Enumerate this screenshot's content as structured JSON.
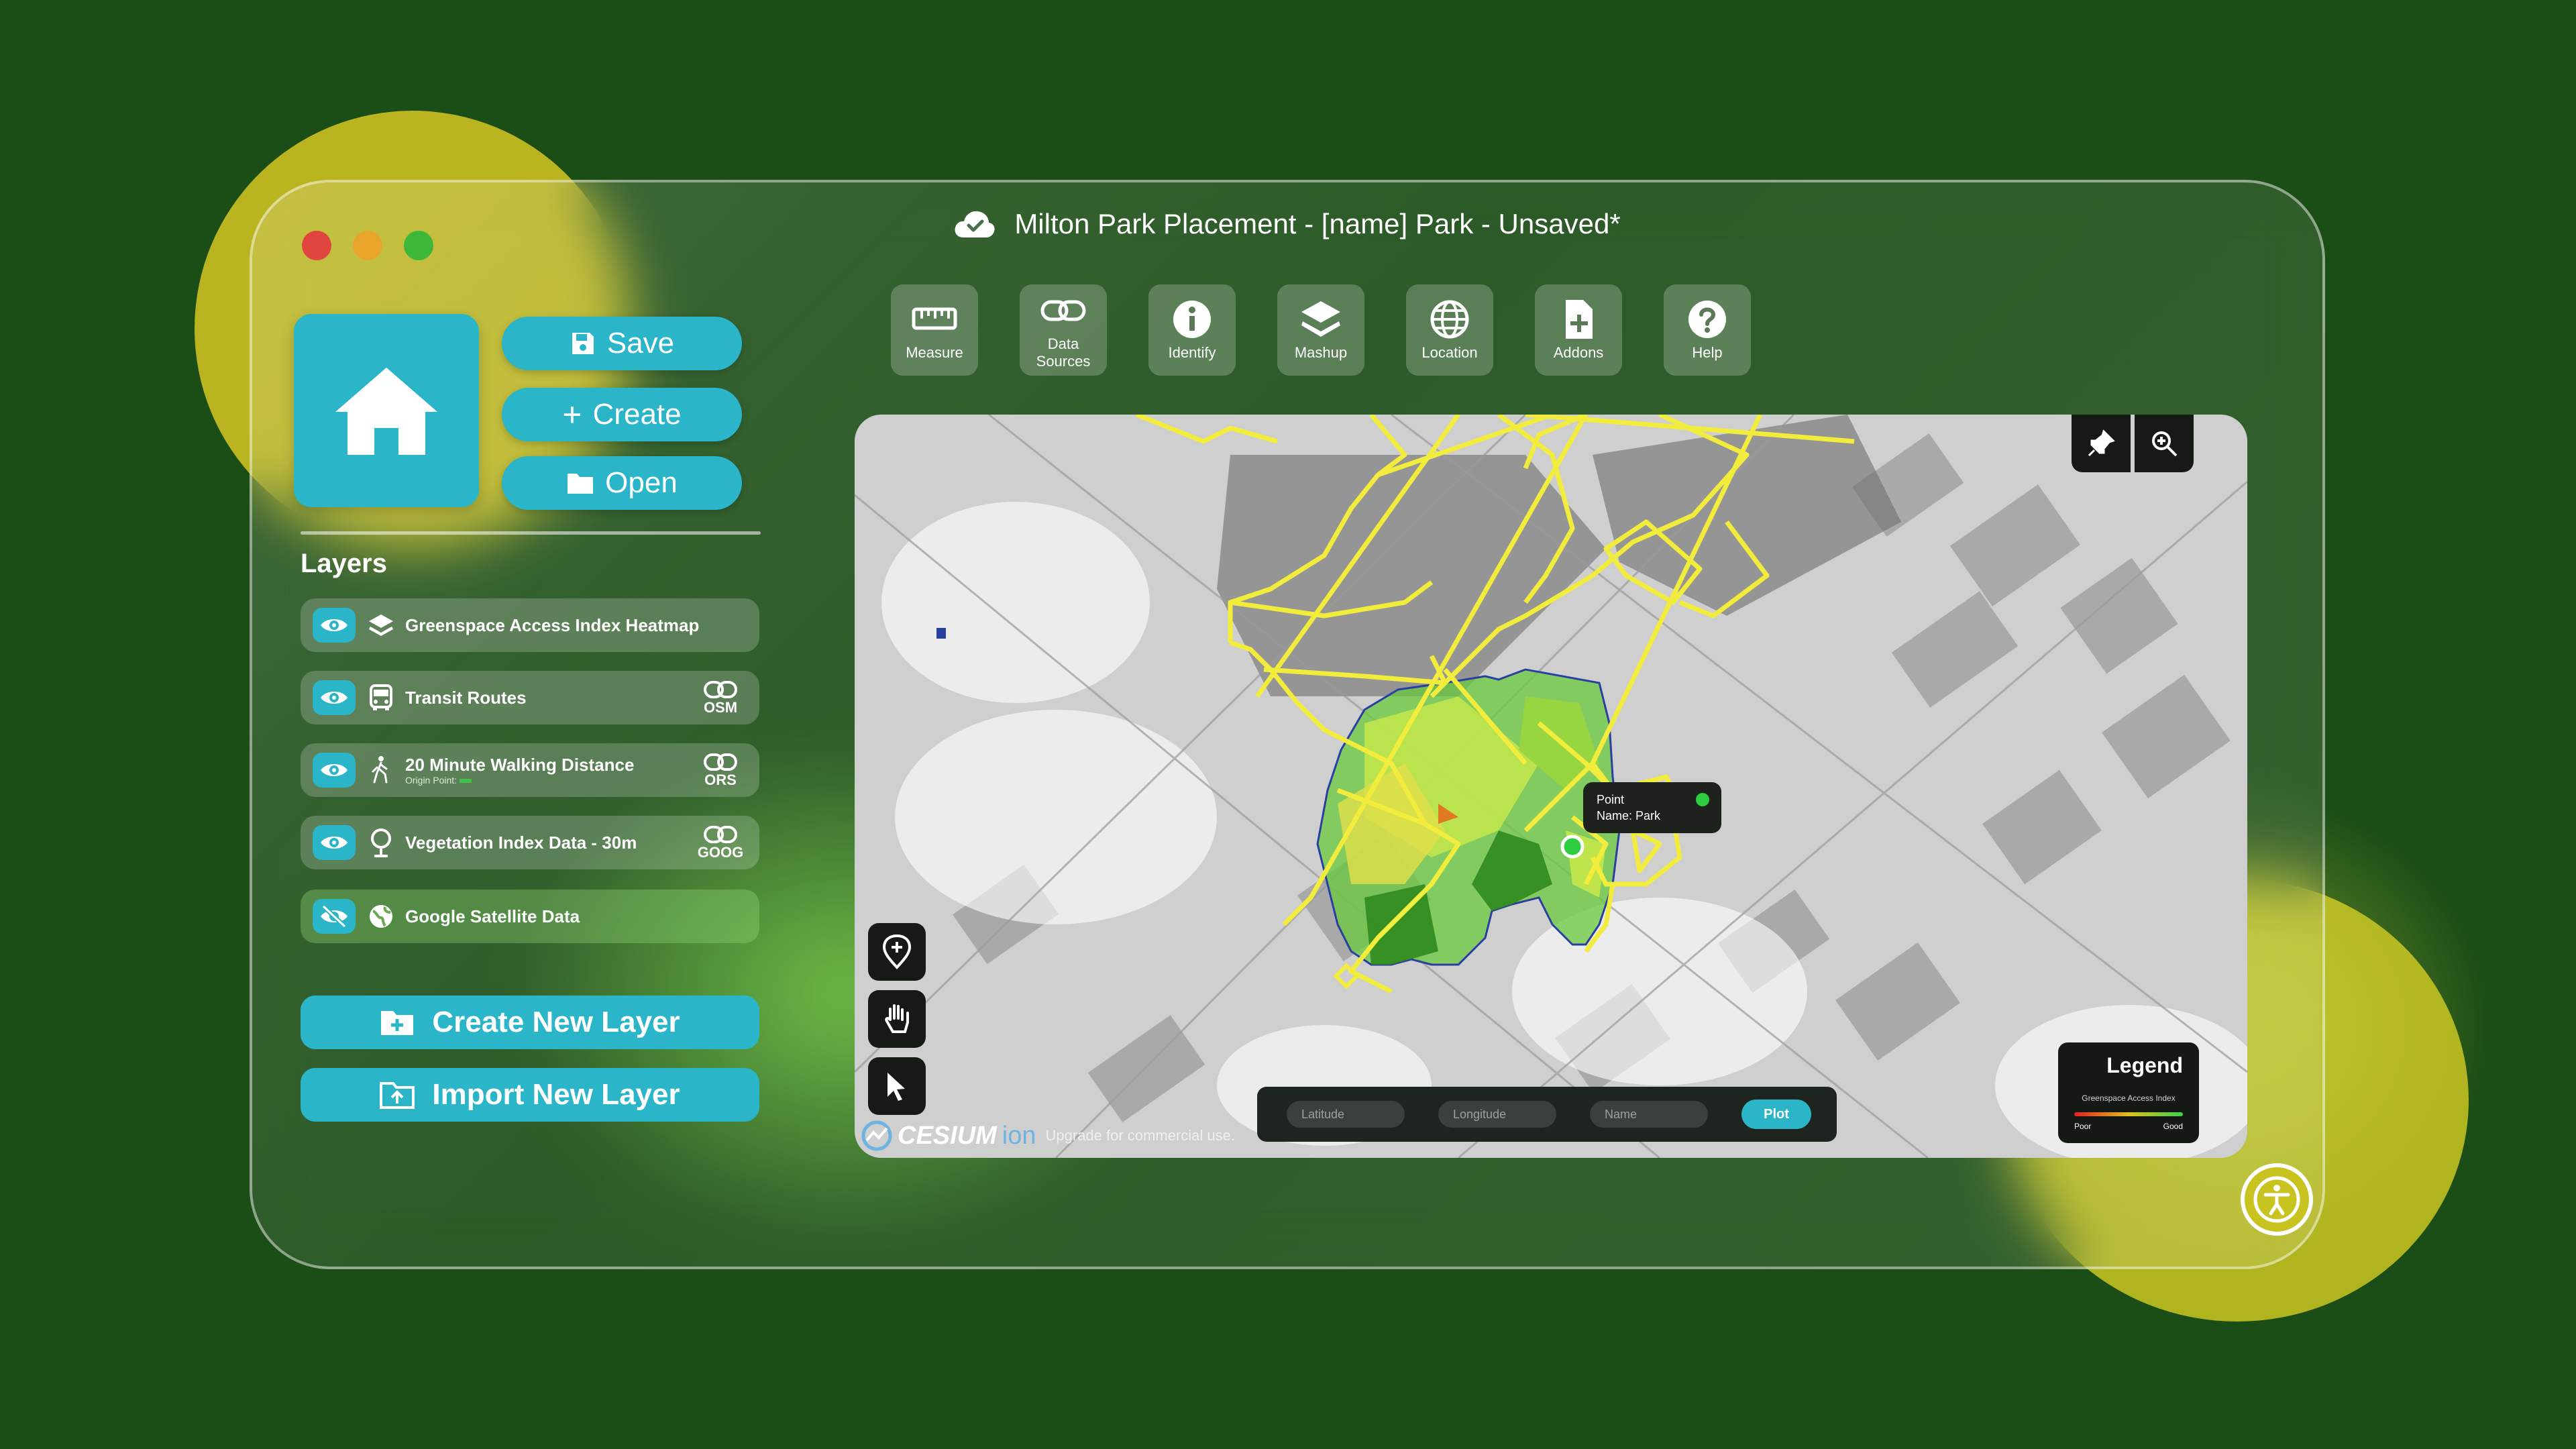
{
  "window": {
    "title": "Milton Park Placement - [name] Park - Unsaved*"
  },
  "actions": {
    "save": "Save",
    "create": "Create",
    "open": "Open"
  },
  "toolbar": {
    "measure": "Measure",
    "data_sources_1": "Data",
    "data_sources_2": "Sources",
    "identify": "Identify",
    "mashup": "Mashup",
    "location": "Location",
    "addons": "Addons",
    "help": "Help"
  },
  "layers": {
    "title": "Layers",
    "items": [
      {
        "label": "Greenspace Access Index Heatmap",
        "visible": true,
        "icon": "stack-icon"
      },
      {
        "label": "Transit Routes",
        "visible": true,
        "icon": "bus-icon",
        "source": "OSM"
      },
      {
        "label": "20 Minute Walking Distance",
        "sub": "Origin Point:",
        "visible": true,
        "icon": "walk-icon",
        "source": "ORS"
      },
      {
        "label": "Vegetation Index Data - 30m",
        "visible": true,
        "icon": "tree-icon",
        "source": "GOOG"
      },
      {
        "label": "Google Satellite Data",
        "visible": false,
        "icon": "globe-icon"
      }
    ],
    "create_new": "Create New Layer",
    "import_new": "Import New Layer"
  },
  "map": {
    "tooltip_line1": "Point",
    "tooltip_line2": "Name: Park",
    "latitude_placeholder": "Latitude",
    "longitude_placeholder": "Longitude",
    "name_placeholder": "Name",
    "plot": "Plot",
    "attribution_brand": "CESIUM",
    "attribution_ion": "ion",
    "attribution_note": "Upgrade for commercial use."
  },
  "legend": {
    "title": "Legend",
    "subtitle": "Greenspace Access Index",
    "low": "Poor",
    "high": "Good",
    "colors": [
      "#e02020",
      "#e0c020",
      "#3dd04a"
    ]
  },
  "colors": {
    "accent": "#2ab5c9",
    "background": "#1b4d16",
    "route": "#f2ec3c"
  }
}
